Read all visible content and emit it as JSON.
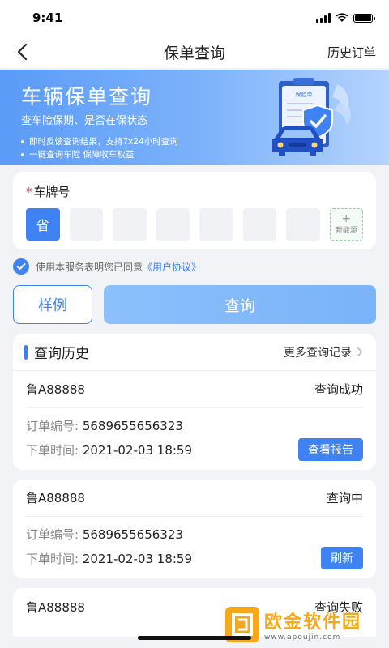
{
  "status_bar": {
    "time": "9:41"
  },
  "nav": {
    "title": "保单查询",
    "right_label": "历史订单"
  },
  "banner": {
    "title": "车辆保单查询",
    "subtitle": "查车险保期、是否在保状态",
    "points": [
      "即时反馈查询结果，支持7x24小时查询",
      "一键查询车险 保障收车权益"
    ],
    "art_label": "保险单"
  },
  "plate": {
    "required_mark": "*",
    "label": "车牌号",
    "first_box": "省",
    "nev_plus": "+",
    "nev_label": "新能源"
  },
  "agreement": {
    "text": "使用本服务表明您已同意",
    "link": "《用户协议》"
  },
  "actions": {
    "sample": "样例",
    "query": "查询"
  },
  "history": {
    "title": "查询历史",
    "more": "更多查询记录",
    "order_label": "订单编号:",
    "time_label": "下单时间:",
    "records": [
      {
        "plate": "鲁A88888",
        "status": "查询成功",
        "order_no": "5689655656323",
        "time": "2021-02-03 18:59",
        "action": "查看报告"
      },
      {
        "plate": "鲁A88888",
        "status": "查询中",
        "order_no": "5689655656323",
        "time": "2021-02-03 18:59",
        "action": "刷新"
      },
      {
        "plate": "鲁A88888",
        "status": "查询失败"
      }
    ]
  },
  "watermark": {
    "text": "欧金软件园",
    "url": "www.apoujin.com"
  },
  "colors": {
    "accent": "#3f82f2",
    "banner_start": "#5a9bf8",
    "banner_end": "#b5d3fd",
    "required": "#e64340",
    "watermark": "#f5a81c"
  }
}
